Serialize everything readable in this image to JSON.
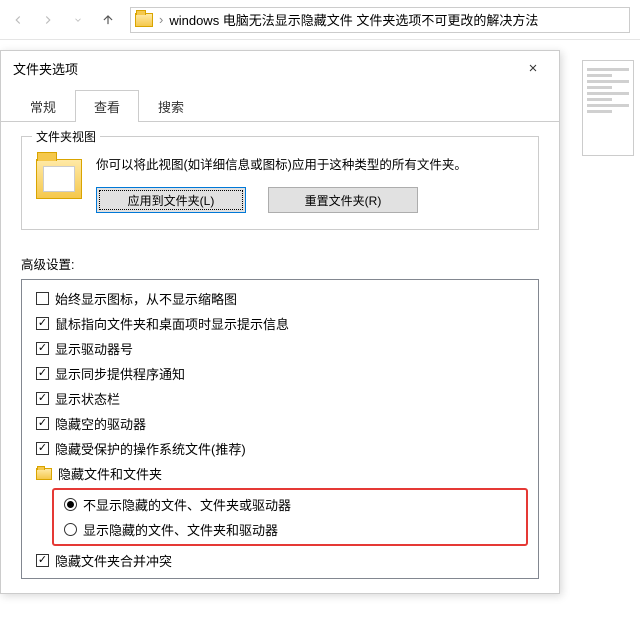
{
  "explorer": {
    "path_text": "windows 电脑无法显示隐藏文件 文件夹选项不可更改的解决方法"
  },
  "dialog": {
    "title": "文件夹选项",
    "tabs": {
      "general": "常规",
      "view": "查看",
      "search": "搜索"
    },
    "folder_view": {
      "group_label": "文件夹视图",
      "desc": "你可以将此视图(如详细信息或图标)应用于这种类型的所有文件夹。",
      "apply_btn": "应用到文件夹(L)",
      "reset_btn": "重置文件夹(R)"
    },
    "advanced_label": "高级设置:",
    "items": [
      {
        "kind": "chk",
        "checked": false,
        "label": "始终显示图标，从不显示缩略图"
      },
      {
        "kind": "chk",
        "checked": true,
        "label": "鼠标指向文件夹和桌面项时显示提示信息"
      },
      {
        "kind": "chk",
        "checked": true,
        "label": "显示驱动器号"
      },
      {
        "kind": "chk",
        "checked": true,
        "label": "显示同步提供程序通知"
      },
      {
        "kind": "chk",
        "checked": true,
        "label": "显示状态栏"
      },
      {
        "kind": "chk",
        "checked": true,
        "label": "隐藏空的驱动器"
      },
      {
        "kind": "chk",
        "checked": true,
        "label": "隐藏受保护的操作系统文件(推荐)"
      },
      {
        "kind": "folder",
        "label": "隐藏文件和文件夹"
      },
      {
        "kind": "rdo",
        "checked": true,
        "label": "不显示隐藏的文件、文件夹或驱动器"
      },
      {
        "kind": "rdo",
        "checked": false,
        "label": "显示隐藏的文件、文件夹和驱动器"
      },
      {
        "kind": "chk",
        "checked": true,
        "label": "隐藏文件夹合并冲突"
      }
    ]
  }
}
